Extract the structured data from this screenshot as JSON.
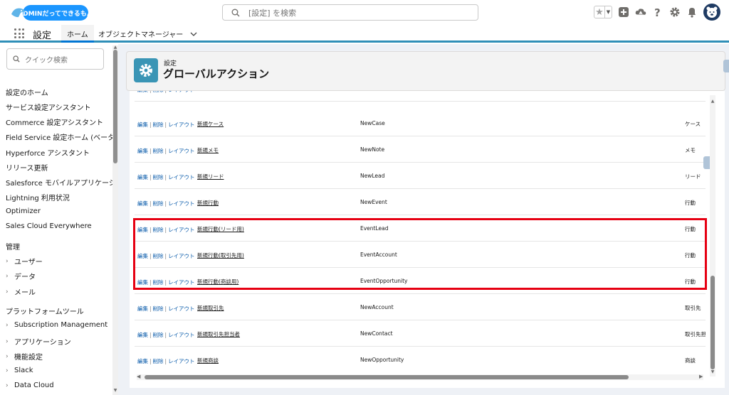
{
  "header": {
    "logo_text": "ADMINだってできるもん",
    "search_placeholder": "[設定] を検索",
    "icons": [
      "favorite-star-icon",
      "favorite-caret-icon",
      "add-icon",
      "trailhead-icon",
      "help-icon",
      "gear-icon",
      "bell-icon",
      "avatar"
    ]
  },
  "nav": {
    "app_name": "設定",
    "tabs": [
      {
        "label": "ホーム"
      },
      {
        "label": "オブジェクトマネージャー"
      }
    ]
  },
  "sidebar": {
    "quick_find_placeholder": "クイック検索",
    "items": [
      "設定のホーム",
      "サービス設定アシスタント",
      "Commerce 設定アシスタント",
      "Field Service 設定ホーム (ベータ)",
      "Hyperforce アシスタント",
      "リリース更新",
      "Salesforce モバイルアプリケーション",
      "Lightning 利用状況",
      "Optimizer",
      "Sales Cloud Everywhere"
    ],
    "section_admin": "管理",
    "admin_items": [
      "ユーザー",
      "データ",
      "メール"
    ],
    "section_platform": "プラットフォームツール",
    "platform_items": [
      "Subscription Management",
      "アプリケーション",
      "機能設定",
      "Slack",
      "Data Cloud"
    ]
  },
  "page": {
    "breadcrumb": "設定",
    "title": "グローバルアクション"
  },
  "table": {
    "action_labels": {
      "edit": "編集",
      "delete": "削除",
      "layout": "レイアウト",
      "sep": "|"
    },
    "rows": [
      {
        "label": "新規ケース",
        "api": "NewCase",
        "object": "ケース"
      },
      {
        "label": "新規メモ",
        "api": "NewNote",
        "object": "メモ"
      },
      {
        "label": "新規リード",
        "api": "NewLead",
        "object": "リード"
      },
      {
        "label": "新規行動",
        "api": "NewEvent",
        "object": "行動"
      },
      {
        "label": "新規行動(リード用)",
        "api": "EventLead",
        "object": "行動"
      },
      {
        "label": "新規行動(取引先用)",
        "api": "EventAccount",
        "object": "行動"
      },
      {
        "label": "新規行動(商談用)",
        "api": "EventOpportunity",
        "object": "行動"
      },
      {
        "label": "新規取引先",
        "api": "NewAccount",
        "object": "取引先"
      },
      {
        "label": "新規取引先担当者",
        "api": "NewContact",
        "object": "取引先担"
      },
      {
        "label": "新規商談",
        "api": "NewOpportunity",
        "object": "商談"
      }
    ]
  },
  "colors": {
    "accent": "#0176d3",
    "highlight": "#e60012",
    "gear_tile": "#3a95b5"
  }
}
